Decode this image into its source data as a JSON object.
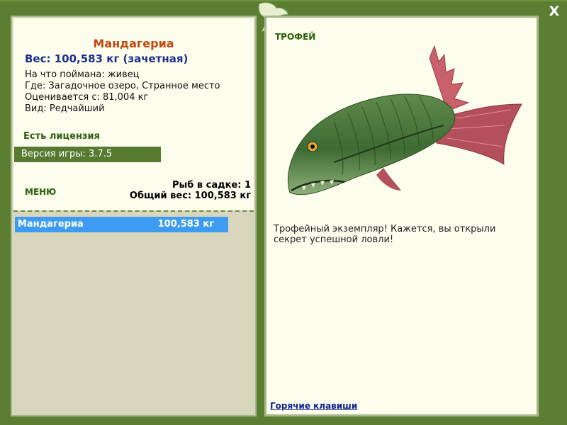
{
  "fish": {
    "name": "Мандагериа",
    "weight_line": "Вес: 100,583 кг (зачетная)",
    "bait": "На что поймана: живец",
    "location": "Где: Загадочное озеро, Странное место",
    "valued_from": "Оценивается с: 81,004 кг",
    "rarity": "Вид: Редчайший"
  },
  "license": "Есть лицензия",
  "version": "Версия игры: 3.7.5",
  "menu_label": "МЕНЮ",
  "keepnet": {
    "count_line": "Рыб в садке: 1",
    "total_line": "Общий вес: 100,583 кг"
  },
  "list": [
    {
      "name": "Мандагериа",
      "weight": "100,583 кг"
    }
  ],
  "trophy": {
    "label": "ТРОФЕЙ",
    "description": "Трофейный экземпляр! Кажется, вы открыли секрет успешной ловли!",
    "hotkeys": "Горячие клавиши"
  },
  "close_label": "X",
  "colors": {
    "frame": "#5b7e33",
    "panel": "#fdfdee",
    "selection": "#3d9cf2",
    "title": "#c24a12",
    "weight": "#1a2e8a"
  }
}
